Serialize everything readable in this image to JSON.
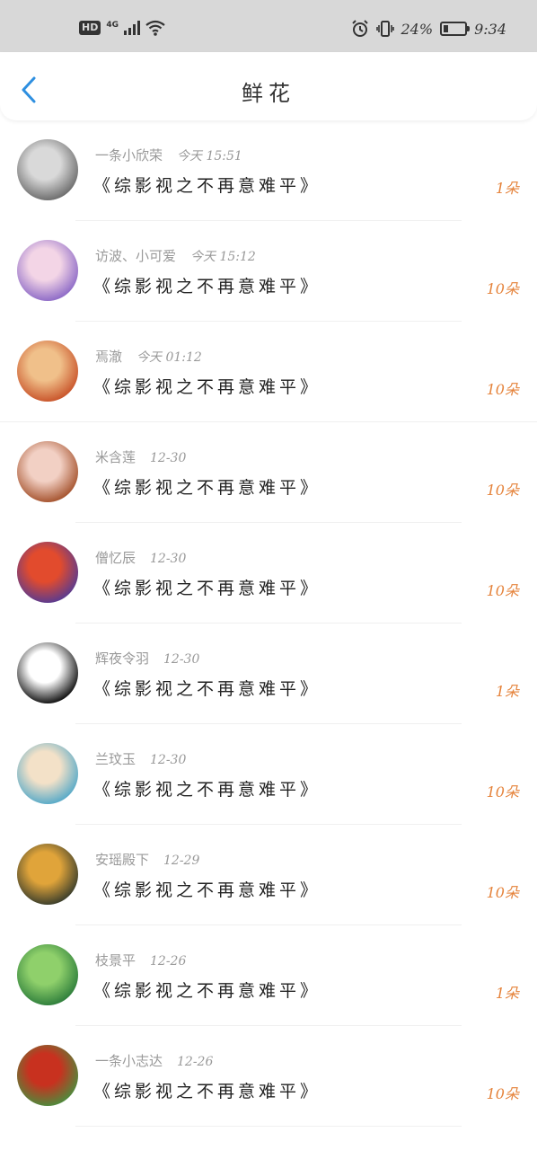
{
  "status_bar": {
    "hd": "HD",
    "network": "4G",
    "battery_text": "24%",
    "battery_level": 0.24,
    "time": "9:34"
  },
  "header": {
    "title": "鲜花",
    "back_icon": "chevron-left-icon",
    "accent": "#2e8fe0"
  },
  "records": [
    {
      "name": "一条小欣荣",
      "time": "今天 15:51",
      "gift": "《综影视之不再意难平》",
      "count": "1朵",
      "avatar_colors": [
        "#6d6d6d",
        "#d9d9d9"
      ]
    },
    {
      "name": "访波、小可爱",
      "time": "今天 15:12",
      "gift": "《综影视之不再意难平》",
      "count": "10朵",
      "avatar_colors": [
        "#8e6bc7",
        "#f3d5e6"
      ]
    },
    {
      "name": "焉澈",
      "time": "今天 01:12",
      "gift": "《综影视之不再意难平》",
      "count": "10朵",
      "avatar_colors": [
        "#c9552b",
        "#f0c08a"
      ]
    },
    {
      "name": "米含莲",
      "time": "12-30",
      "gift": "《综影视之不再意难平》",
      "count": "10朵",
      "avatar_colors": [
        "#a6542f",
        "#f2d0c4"
      ]
    },
    {
      "name": "僧忆辰",
      "time": "12-30",
      "gift": "《综影视之不再意难平》",
      "count": "10朵",
      "avatar_colors": [
        "#5b3b8f",
        "#e24b2d"
      ]
    },
    {
      "name": "辉夜令羽",
      "time": "12-30",
      "gift": "《综影视之不再意难平》",
      "count": "1朵",
      "avatar_colors": [
        "#111111",
        "#ffffff"
      ]
    },
    {
      "name": "兰玟玉",
      "time": "12-30",
      "gift": "《综影视之不再意难平》",
      "count": "10朵",
      "avatar_colors": [
        "#58aac8",
        "#f3e1c8"
      ]
    },
    {
      "name": "安瑶殿下",
      "time": "12-29",
      "gift": "《综影视之不再意难平》",
      "count": "10朵",
      "avatar_colors": [
        "#3c3f2c",
        "#e0a43a"
      ]
    },
    {
      "name": "枝景平",
      "time": "12-26",
      "gift": "《综影视之不再意难平》",
      "count": "1朵",
      "avatar_colors": [
        "#2f7f3c",
        "#8fd06b"
      ]
    },
    {
      "name": "一条小志达",
      "time": "12-26",
      "gift": "《综影视之不再意难平》",
      "count": "10朵",
      "avatar_colors": [
        "#4f8a3c",
        "#c8311f"
      ]
    }
  ]
}
